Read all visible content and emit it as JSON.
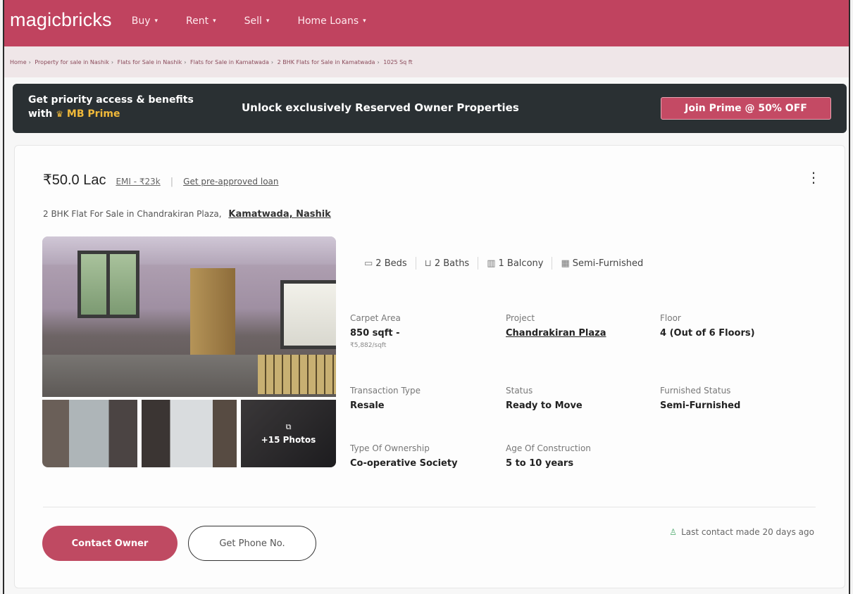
{
  "header": {
    "logo": "magicbricks",
    "nav": [
      {
        "label": "Buy"
      },
      {
        "label": "Rent"
      },
      {
        "label": "Sell"
      },
      {
        "label": "Home Loans"
      }
    ]
  },
  "breadcrumb": [
    "Home",
    "Property for sale in Nashik",
    "Flats for Sale in Nashik",
    "Flats for Sale in Kamatwada",
    "2 BHK Flats for Sale in Kamatwada",
    "1025 Sq ft"
  ],
  "prime": {
    "line1": "Get priority access & benefits",
    "line2_prefix": "with",
    "line2_brand": "MB Prime",
    "middle": "Unlock exclusively Reserved Owner Properties",
    "button": "Join Prime @ 50% OFF"
  },
  "listing": {
    "price": "₹50.0 Lac",
    "emi": "EMI - ₹23k",
    "loan_link": "Get pre-approved loan",
    "title": "2 BHK Flat For Sale in Chandrakiran Plaza,",
    "location": "Kamatwada, Nashik",
    "more_photos": "+15 Photos",
    "amenities": [
      {
        "icon": "bed-icon",
        "label": "2 Beds"
      },
      {
        "icon": "bath-icon",
        "label": "2 Baths"
      },
      {
        "icon": "balcony-icon",
        "label": "1 Balcony"
      },
      {
        "icon": "furniture-icon",
        "label": "Semi-Furnished"
      }
    ],
    "details": {
      "carpet_area": {
        "label": "Carpet Area",
        "value": "850 sqft -",
        "sub": "₹5,882/sqft"
      },
      "project": {
        "label": "Project",
        "value": "Chandrakiran Plaza"
      },
      "floor": {
        "label": "Floor",
        "value": "4 (Out of 6 Floors)"
      },
      "transaction": {
        "label": "Transaction Type",
        "value": "Resale"
      },
      "status": {
        "label": "Status",
        "value": "Ready to Move"
      },
      "furnished": {
        "label": "Furnished Status",
        "value": "Semi-Furnished"
      },
      "ownership": {
        "label": "Type Of Ownership",
        "value": "Co-operative Society"
      },
      "age": {
        "label": "Age Of Construction",
        "value": "5 to 10 years"
      }
    },
    "contact_button": "Contact Owner",
    "phone_button": "Get Phone No.",
    "last_contact": "Last contact made 20 days ago"
  },
  "colors": {
    "brand": "#c0435f",
    "prime_bg": "#2a3033",
    "prime_accent": "#f0b93a"
  }
}
